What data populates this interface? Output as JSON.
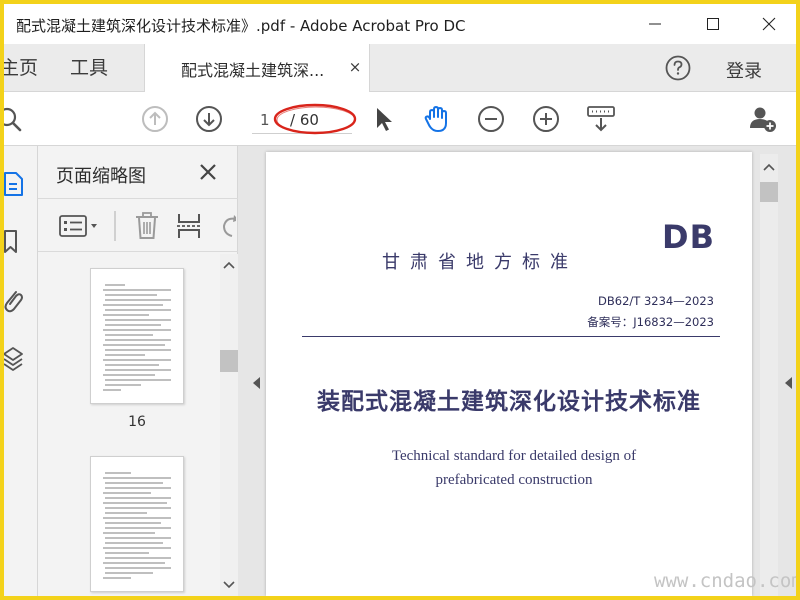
{
  "window": {
    "title": "配式混凝土建筑深化设计技术标准》.pdf - Adobe Acrobat Pro DC",
    "minimize_symbol": "—",
    "maximize_symbol": "☐",
    "close_symbol": "✕"
  },
  "tabs": {
    "home_label": "主页",
    "tools_label": "工具",
    "document_tab_label": "配式混凝土建筑深...",
    "document_tab_close": "×",
    "sign_in_label": "登录"
  },
  "toolbar": {
    "current_page": "1",
    "page_total": "/ 60",
    "icons": [
      "search-icon",
      "page-up-icon",
      "page-down-icon",
      "select-pointer-icon",
      "hand-tool-icon",
      "zoom-out-icon",
      "zoom-in-icon",
      "keyboard-scroll-icon",
      "add-user-icon"
    ]
  },
  "thumbnail_panel": {
    "title": "页面缩略图",
    "close_symbol": "✕",
    "pages": [
      {
        "label": "16"
      },
      {
        "label": ""
      }
    ]
  },
  "document": {
    "db_mark": "DB",
    "issuing_org": "甘肃省地方标准",
    "standard_number": "DB62/T 3234—2023",
    "record_number": "备案号：J16832—2023",
    "title_cn": "装配式混凝土建筑深化设计技术标准",
    "title_en_line1": "Technical standard for detailed design of",
    "title_en_line2": "prefabricated construction"
  },
  "watermark": {
    "url": "www.cndao.com"
  },
  "colors": {
    "frame_border": "#f3d21a",
    "highlight_ring": "#d9241b",
    "doc_text": "#3a3a6a",
    "hand_tool": "#1473e6"
  }
}
